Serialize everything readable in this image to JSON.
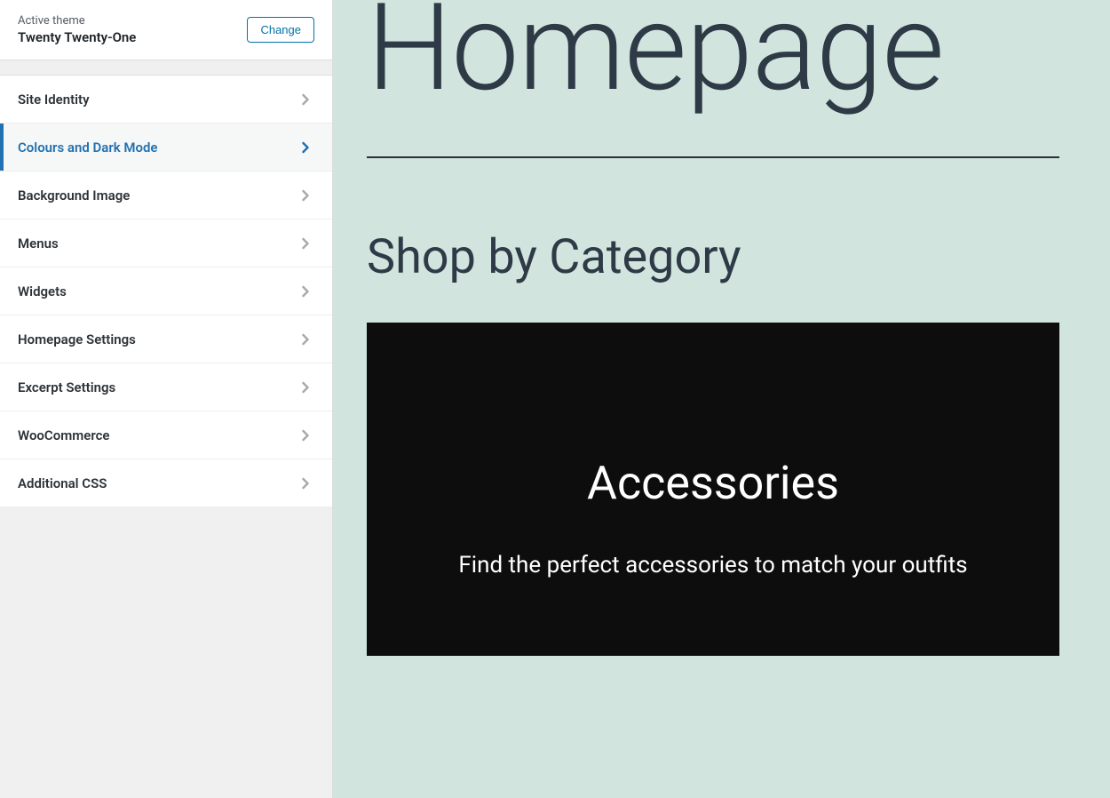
{
  "theme": {
    "active_label": "Active theme",
    "name": "Twenty Twenty-One",
    "change_label": "Change"
  },
  "sections": [
    {
      "label": "Site Identity",
      "active": false
    },
    {
      "label": "Colours and Dark Mode",
      "active": true
    },
    {
      "label": "Background Image",
      "active": false
    },
    {
      "label": "Menus",
      "active": false
    },
    {
      "label": "Widgets",
      "active": false
    },
    {
      "label": "Homepage Settings",
      "active": false
    },
    {
      "label": "Excerpt Settings",
      "active": false
    },
    {
      "label": "WooCommerce",
      "active": false
    },
    {
      "label": "Additional CSS",
      "active": false
    }
  ],
  "preview": {
    "page_title": "Homepage",
    "section_heading": "Shop by Category",
    "category": {
      "title": "Accessories",
      "description": "Find the perfect accessories to match your outfits"
    }
  }
}
